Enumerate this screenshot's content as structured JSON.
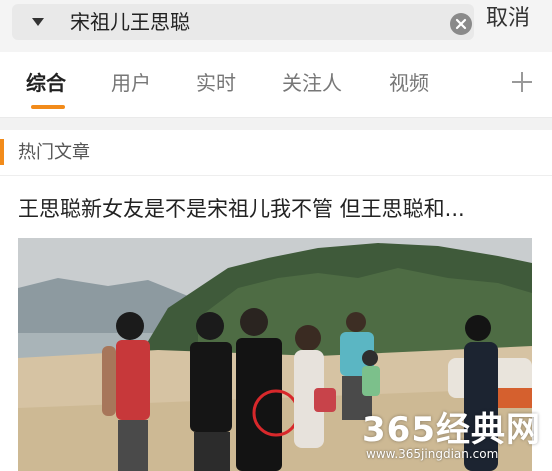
{
  "search": {
    "query": "宋祖儿王思聪",
    "cancel_label": "取消"
  },
  "tabs": [
    {
      "label": "综合",
      "active": true
    },
    {
      "label": "用户",
      "active": false
    },
    {
      "label": "实时",
      "active": false
    },
    {
      "label": "关注人",
      "active": false
    },
    {
      "label": "视频",
      "active": false
    }
  ],
  "section": {
    "title": "热门文章"
  },
  "article": {
    "title": "王思聪新女友是不是宋祖儿我不管 但王思聪和..."
  },
  "watermark": {
    "brand": "365经典网",
    "url": "www.365jingdian.com"
  },
  "colors": {
    "accent": "#f28b1a",
    "topbar_bg": "#f4f4f4",
    "search_bg": "#e9e9e9"
  },
  "icons": {
    "dropdown": "chevron-down-icon",
    "clear": "clear-icon",
    "add": "plus-icon"
  }
}
